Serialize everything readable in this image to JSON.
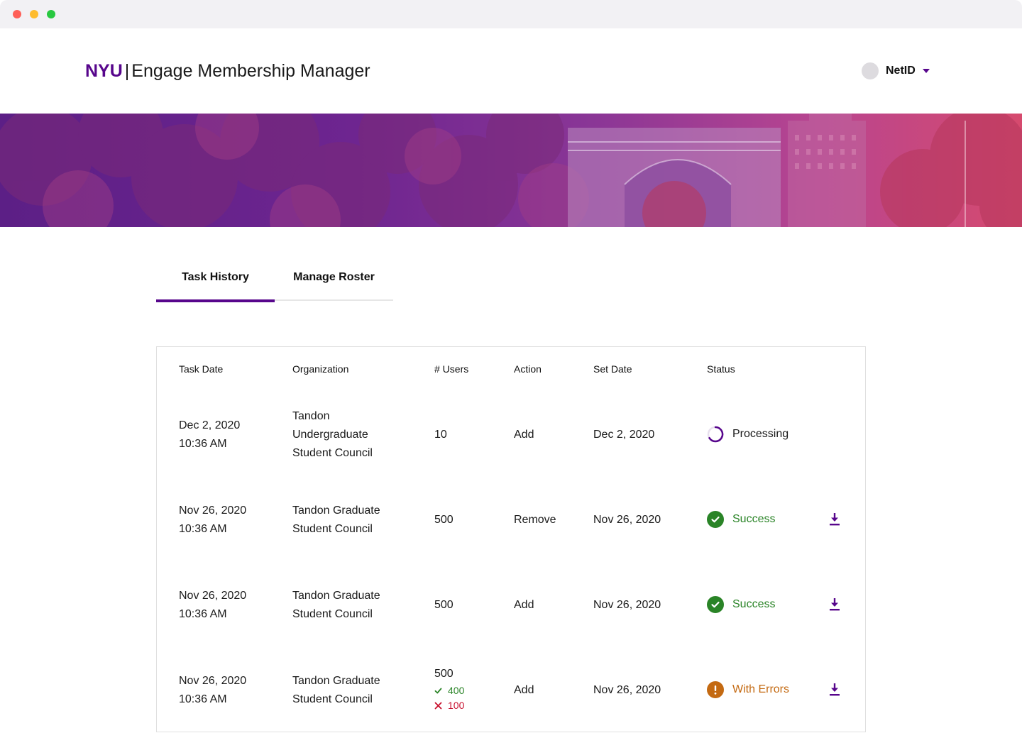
{
  "header": {
    "brand": "NYU",
    "separator": "|",
    "app_title": "Engage Membership Manager",
    "user_label": "NetID"
  },
  "colors": {
    "brand_purple": "#57068c",
    "success_green": "#2a8427",
    "error_orange": "#c46a12",
    "error_red": "#c8102e"
  },
  "tabs": [
    {
      "label": "Task History",
      "active": true
    },
    {
      "label": "Manage Roster",
      "active": false
    }
  ],
  "table": {
    "columns": [
      "Task Date",
      "Organization",
      "# Users",
      "Action",
      "Set Date",
      "Status"
    ],
    "rows": [
      {
        "task_date": "Dec 2, 2020",
        "task_time": "10:36 AM",
        "organization": [
          "Tandon",
          "Undergraduate",
          "Student Council"
        ],
        "users": "10",
        "action": "Add",
        "set_date": "Dec 2, 2020",
        "status": "Processing",
        "status_icon": "spinner-icon"
      },
      {
        "task_date": "Nov 26, 2020",
        "task_time": "10:36 AM",
        "organization": [
          "Tandon Graduate",
          "Student Council"
        ],
        "users": "500",
        "action": "Remove",
        "set_date": "Nov 26, 2020",
        "status": "Success",
        "status_icon": "check-circle-icon",
        "download_icon": "download-icon"
      },
      {
        "task_date": "Nov 26, 2020",
        "task_time": "10:36 AM",
        "organization": [
          "Tandon Graduate",
          "Student Council"
        ],
        "users": "500",
        "action": "Add",
        "set_date": "Nov 26, 2020",
        "status": "Success",
        "status_icon": "check-circle-icon",
        "download_icon": "download-icon"
      },
      {
        "task_date": "Nov 26, 2020",
        "task_time": "10:36 AM",
        "organization": [
          "Tandon Graduate",
          "Student Council"
        ],
        "users": "500",
        "users_success": "400",
        "users_failed": "100",
        "action": "Add",
        "set_date": "Nov 26, 2020",
        "status": "With Errors",
        "status_icon": "exclamation-circle-icon",
        "download_icon": "download-icon"
      }
    ]
  }
}
